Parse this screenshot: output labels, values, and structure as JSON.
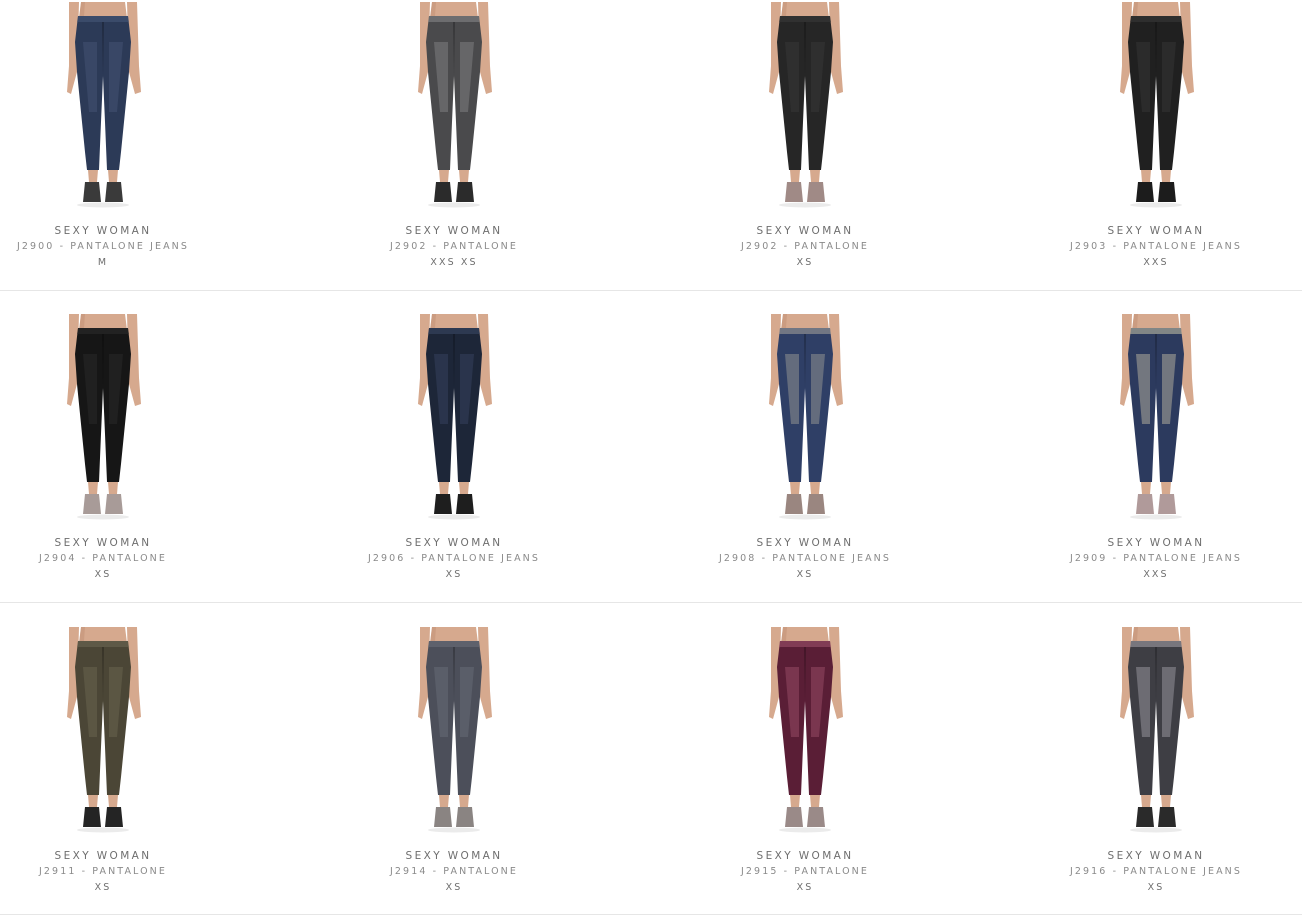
{
  "products": [
    {
      "brand": "SEXY WOMAN",
      "name": "J2900 - PANTALONE JEANS",
      "sizes": "M",
      "pant": "#2c3a57",
      "accent": "#49597a",
      "shoe": "#3a3a3a"
    },
    {
      "brand": "SEXY WOMAN",
      "name": "J2902 - PANTALONE",
      "sizes": "XXS XS",
      "pant": "#4a4a4c",
      "accent": "#8a8a8c",
      "shoe": "#2b2b2b"
    },
    {
      "brand": "SEXY WOMAN",
      "name": "J2902 - PANTALONE",
      "sizes": "XS",
      "pant": "#262626",
      "accent": "#3b3b3b",
      "shoe": "#a08a86"
    },
    {
      "brand": "SEXY WOMAN",
      "name": "J2903 - PANTALONE JEANS",
      "sizes": "XXS",
      "pant": "#202020",
      "accent": "#3a3a3a",
      "shoe": "#1c1c1c"
    },
    {
      "brand": "SEXY WOMAN",
      "name": "J2904 - PANTALONE",
      "sizes": "XS",
      "pant": "#161616",
      "accent": "#2d2d2d",
      "shoe": "#a89b98"
    },
    {
      "brand": "SEXY WOMAN",
      "name": "J2906 - PANTALONE JEANS",
      "sizes": "XS",
      "pant": "#1d2638",
      "accent": "#3b4866",
      "shoe": "#1e1e1e"
    },
    {
      "brand": "SEXY WOMAN",
      "name": "J2908 - PANTALONE JEANS",
      "sizes": "XS",
      "pant": "#2f3f66",
      "accent": "#a7a49a",
      "shoe": "#9a8680"
    },
    {
      "brand": "SEXY WOMAN",
      "name": "J2909 - PANTALONE JEANS",
      "sizes": "XXS",
      "pant": "#2c3a5e",
      "accent": "#c9c4a8",
      "shoe": "#b09a9a"
    },
    {
      "brand": "SEXY WOMAN",
      "name": "J2911 - PANTALONE",
      "sizes": "XS",
      "pant": "#4b4636",
      "accent": "#6f6a55",
      "shoe": "#242424"
    },
    {
      "brand": "SEXY WOMAN",
      "name": "J2914 - PANTALONE",
      "sizes": "XS",
      "pant": "#4c4f5a",
      "accent": "#6d717c",
      "shoe": "#8a8482"
    },
    {
      "brand": "SEXY WOMAN",
      "name": "J2915 - PANTALONE",
      "sizes": "XS",
      "pant": "#5a1e36",
      "accent": "#a2556f",
      "shoe": "#9a8a88"
    },
    {
      "brand": "SEXY WOMAN",
      "name": "J2916 - PANTALONE JEANS",
      "sizes": "XS",
      "pant": "#3e3e44",
      "accent": "#a7a4ad",
      "shoe": "#2a2a2a"
    }
  ],
  "colors": {
    "skin": "#d6a98e",
    "skin_shadow": "#c08f74"
  }
}
